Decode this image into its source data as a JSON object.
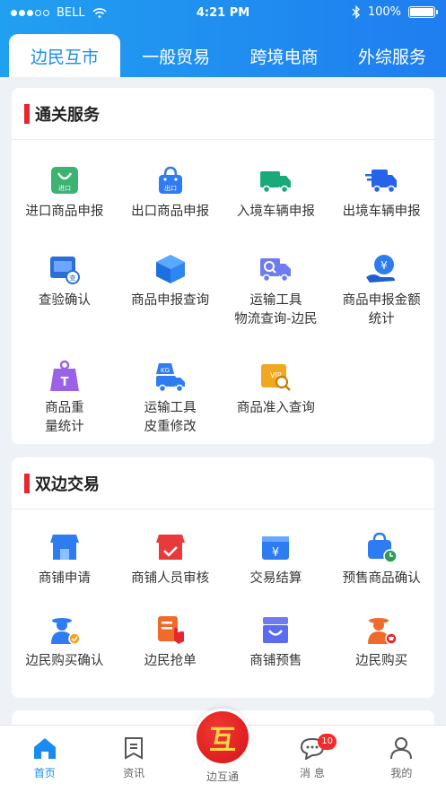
{
  "status": {
    "carrier": "BELL",
    "time": "4:21 PM",
    "battery": "100%"
  },
  "tabs": [
    {
      "label": "边民互市",
      "active": true
    },
    {
      "label": "一般贸易"
    },
    {
      "label": "跨境电商"
    },
    {
      "label": "外综服务"
    }
  ],
  "customs": {
    "title": "通关服务",
    "items": [
      {
        "label": "进口商品申报",
        "icon": "import-bag-icon"
      },
      {
        "label": "出口商品申报",
        "icon": "export-basket-icon"
      },
      {
        "label": "入境车辆申报",
        "icon": "truck-in-icon"
      },
      {
        "label": "出境车辆申报",
        "icon": "truck-out-icon"
      },
      {
        "label": "查验确认",
        "icon": "inspection-icon"
      },
      {
        "label": "商品申报查询",
        "icon": "box-icon"
      },
      {
        "label": "运输工具\n物流查询-边民",
        "icon": "truck-search-icon"
      },
      {
        "label": "商品申报金额\n统计",
        "icon": "money-hand-icon"
      },
      {
        "label": "商品重\n量统计",
        "icon": "weight-icon"
      },
      {
        "label": "运输工具\n皮重修改",
        "icon": "truck-weight-icon"
      },
      {
        "label": "商品准入查询",
        "icon": "vip-search-icon"
      }
    ]
  },
  "trade": {
    "title": "双边交易",
    "items": [
      {
        "label": "商铺申请",
        "icon": "shop-icon"
      },
      {
        "label": "商铺人员审核",
        "icon": "shop-check-icon"
      },
      {
        "label": "交易结算",
        "icon": "yuan-wallet-icon"
      },
      {
        "label": "预售商品确认",
        "icon": "presale-bag-icon"
      },
      {
        "label": "边民购买确认",
        "icon": "person-check-icon"
      },
      {
        "label": "边民抢单",
        "icon": "grab-order-icon"
      },
      {
        "label": "商铺预售",
        "icon": "shop-presale-icon"
      },
      {
        "label": "边民购买",
        "icon": "person-cart-icon"
      }
    ]
  },
  "nav": {
    "home": "首页",
    "news": "资讯",
    "center": "边互通",
    "center_logo": "互",
    "messages": "消 息",
    "messages_badge": "10",
    "mine": "我的"
  },
  "colors": {
    "accent": "#1a8cf0",
    "section_bar": "#e8262e"
  }
}
